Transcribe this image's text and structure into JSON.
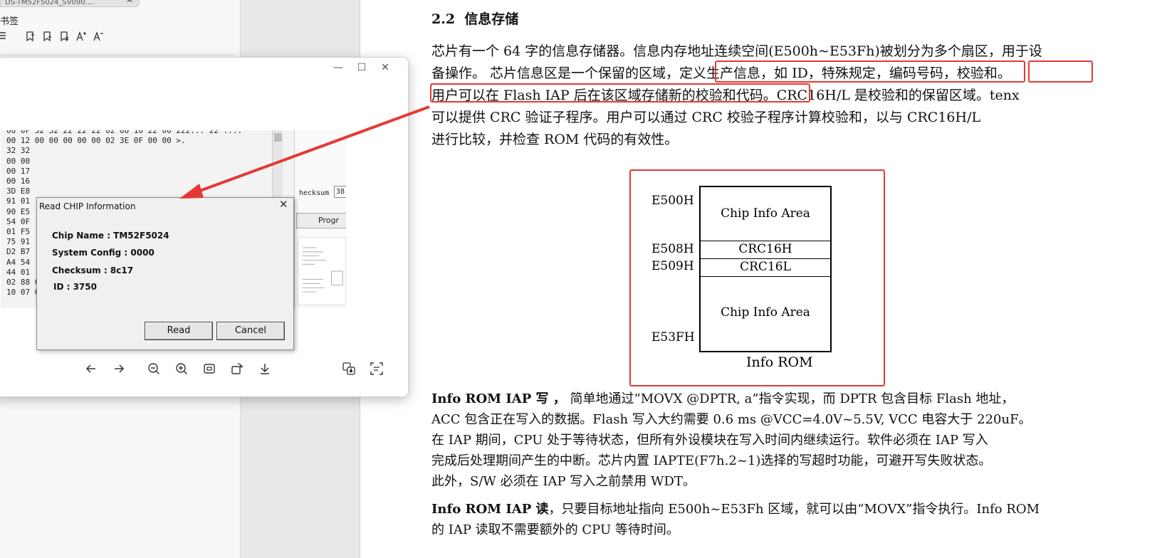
{
  "sidebar": {
    "tab_title": "DS-TM52F5024_SV090....",
    "tab_close": "✕",
    "bookmarks_label": "书签"
  },
  "viewer": {
    "minimize": "—",
    "maximize": "☐",
    "close": "✕",
    "hex_rows": [
      "00 0F 32 32 22 22 22 02 00 10 22 00 222:.. 22    ....",
      "00 12 00 00 00 00 00 02 3E 0F 00 00           >.",
      "32 32",
      "00 00",
      "00 17",
      "00 16",
      "3D E8",
      "91 01",
      "90 E5",
      "54 0F",
      "01 F5",
      "75 91",
      "D2 B7",
      "A4 54",
      "44 01",
      "02 88 02 03 28 03 03 D2 04 04 0A 05 .........(.....]:",
      "10 07 09 1C 02 00 EC 00 00 00 07 14 ..........."
    ],
    "checksum_label": "hecksum",
    "checksum_value": "38",
    "program_button": "Progr",
    "dialog": {
      "title": "Read CHIP Information",
      "close": "✕",
      "chip_name": "Chip Name : TM52F5024",
      "system_config": "System Config : 0000",
      "checksum": "Checksum : 8c17",
      "id": "ID : 3750",
      "read_button": "Read",
      "cancel_button": "Cancel"
    }
  },
  "doc": {
    "section_number": "2.2",
    "section_title": "信息存储",
    "para1": {
      "line1": "芯片有一个 64 字的信息存储器。信息内存地址连续空间(E500h~E53Fh)被划分为多个扇区，用于设",
      "line2_a": "备操作。 芯片信息区是一个保留的区域，",
      "line2_b": "定义生产信息，如 ID，特殊规定，编码号码，",
      "line2_c": "校验和。",
      "line3_a": "用户可以在 Flash IAP 后在该区域存储新的校验和代码。",
      "line3_b": "CRC16H/L 是校验和的保留区域。tenx",
      "line4": "可以提供 CRC 验证子程序。用户可以通过 CRC 校验子程序计算校验和，以与 CRC16H/L",
      "line5": "进行比较，并检查 ROM 代码的有效性。"
    },
    "diagram": {
      "addr_e500": "E500H",
      "addr_e508": "E508H",
      "addr_e509": "E509H",
      "addr_e53f": "E53FH",
      "cell_top": "Chip Info Area",
      "cell_crc_h": "CRC16H",
      "cell_crc_l": "CRC16L",
      "cell_bottom": "Chip Info Area",
      "caption": "Info ROM"
    },
    "para2": {
      "lead": "Info ROM IAP  写 ，",
      "line1": "  简单地通过“MOVX @DPTR, a”指令实现，而 DPTR 包含目标 Flash 地址，",
      "line2": "ACC 包含正在写入的数据。Flash 写入大约需要 0.6 ms @VCC=4.0V~5.5V, VCC 电容大于 220uF。",
      "line3": "在 IAP 期间，CPU 处于等待状态，但所有外设模块在写入时间内继续运行。软件必须在 IAP 写入",
      "line4": "完成后处理期间产生的中断。芯片内置  IAPTE(F7h.2~1)选择的写超时功能，可避开写失败状态。",
      "line5": "此外，S/W  必须在  IAP  写入之前禁用  WDT。"
    },
    "para3": {
      "lead": "Info ROM IAP  读",
      "line1": "，只要目标地址指向 E500h~E53Fh 区域，就可以由“MOVX”指令执行。Info ROM",
      "line2": "的 IAP 读取不需要额外的 CPU 等待时间。"
    }
  }
}
